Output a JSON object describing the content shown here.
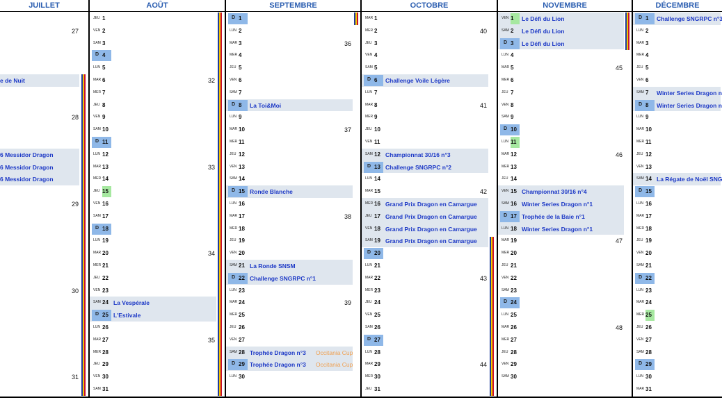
{
  "months": [
    {
      "name": "JUILLET",
      "key": "jul",
      "events": [
        {
          "day": 6,
          "text": "e de Nuit"
        },
        {
          "day": 12,
          "text": "6 Messidor Dragon"
        },
        {
          "day": 13,
          "text": "6 Messidor Dragon"
        },
        {
          "day": 14,
          "text": "6 Messidor Dragon"
        }
      ],
      "weeks": [
        {
          "day": 2,
          "wk": "27"
        },
        {
          "day": 9,
          "wk": "28"
        },
        {
          "day": 16,
          "wk": "29"
        },
        {
          "day": 23,
          "wk": "30"
        },
        {
          "day": 30,
          "wk": "31"
        }
      ]
    },
    {
      "name": "AOÛT",
      "key": "aug",
      "days": [
        {
          "d": "1",
          "w": "JEU"
        },
        {
          "d": "2",
          "w": "VEN"
        },
        {
          "d": "3",
          "w": "SAM"
        },
        {
          "d": "4",
          "w": "D"
        },
        {
          "d": "5",
          "w": "LUN"
        },
        {
          "d": "6",
          "w": "MAR"
        },
        {
          "d": "7",
          "w": "MER"
        },
        {
          "d": "8",
          "w": "JEU"
        },
        {
          "d": "9",
          "w": "VEN"
        },
        {
          "d": "10",
          "w": "SAM"
        },
        {
          "d": "11",
          "w": "D"
        },
        {
          "d": "12",
          "w": "LUN"
        },
        {
          "d": "13",
          "w": "MAR"
        },
        {
          "d": "14",
          "w": "MER"
        },
        {
          "d": "15",
          "w": "JEU",
          "hol": true
        },
        {
          "d": "16",
          "w": "VEN"
        },
        {
          "d": "17",
          "w": "SAM"
        },
        {
          "d": "18",
          "w": "D"
        },
        {
          "d": "19",
          "w": "LUN"
        },
        {
          "d": "20",
          "w": "MAR"
        },
        {
          "d": "21",
          "w": "MER"
        },
        {
          "d": "22",
          "w": "JEU"
        },
        {
          "d": "23",
          "w": "VEN"
        },
        {
          "d": "24",
          "w": "SAM",
          "ev": "La Vespérale"
        },
        {
          "d": "25",
          "w": "D",
          "ev": "L'Estivale"
        },
        {
          "d": "26",
          "w": "LUN"
        },
        {
          "d": "27",
          "w": "MAR"
        },
        {
          "d": "28",
          "w": "MER"
        },
        {
          "d": "29",
          "w": "JEU"
        },
        {
          "d": "30",
          "w": "VEN"
        },
        {
          "d": "31",
          "w": "SAM"
        }
      ],
      "weeks": [
        {
          "day": 6,
          "wk": "32"
        },
        {
          "day": 13,
          "wk": "33"
        },
        {
          "day": 20,
          "wk": "34"
        },
        {
          "day": 27,
          "wk": "35"
        }
      ]
    },
    {
      "name": "SEPTEMBRE",
      "key": "sep",
      "days": [
        {
          "d": "1",
          "w": "D"
        },
        {
          "d": "2",
          "w": "LUN"
        },
        {
          "d": "3",
          "w": "MAR"
        },
        {
          "d": "4",
          "w": "MER"
        },
        {
          "d": "5",
          "w": "JEU"
        },
        {
          "d": "6",
          "w": "VEN"
        },
        {
          "d": "7",
          "w": "SAM"
        },
        {
          "d": "8",
          "w": "D",
          "ev": "La Toi&Moi"
        },
        {
          "d": "9",
          "w": "LUN"
        },
        {
          "d": "10",
          "w": "MAR"
        },
        {
          "d": "11",
          "w": "MER"
        },
        {
          "d": "12",
          "w": "JEU"
        },
        {
          "d": "13",
          "w": "VEN"
        },
        {
          "d": "14",
          "w": "SAM"
        },
        {
          "d": "15",
          "w": "D",
          "ev": "Ronde Blanche"
        },
        {
          "d": "16",
          "w": "LUN"
        },
        {
          "d": "17",
          "w": "MAR"
        },
        {
          "d": "18",
          "w": "MER"
        },
        {
          "d": "19",
          "w": "JEU"
        },
        {
          "d": "20",
          "w": "VEN"
        },
        {
          "d": "21",
          "w": "SAM",
          "ev": "La Ronde SNSM"
        },
        {
          "d": "22",
          "w": "D",
          "ev": "Challenge SNGRPC n°1"
        },
        {
          "d": "23",
          "w": "LUN"
        },
        {
          "d": "24",
          "w": "MAR"
        },
        {
          "d": "25",
          "w": "MER"
        },
        {
          "d": "26",
          "w": "JEU"
        },
        {
          "d": "27",
          "w": "VEN"
        },
        {
          "d": "28",
          "w": "SAM",
          "ev": "Trophée Dragon n°3",
          "ev2": "Occitania Cup"
        },
        {
          "d": "29",
          "w": "D",
          "ev": "Trophée Dragon n°3",
          "ev2": "Occitania Cup"
        },
        {
          "d": "30",
          "w": "LUN"
        }
      ],
      "weeks": [
        {
          "day": 3,
          "wk": "36"
        },
        {
          "day": 10,
          "wk": "37"
        },
        {
          "day": 17,
          "wk": "38"
        },
        {
          "day": 24,
          "wk": "39"
        }
      ]
    },
    {
      "name": "OCTOBRE",
      "key": "oct",
      "days": [
        {
          "d": "1",
          "w": "MAR"
        },
        {
          "d": "2",
          "w": "MER"
        },
        {
          "d": "3",
          "w": "JEU"
        },
        {
          "d": "4",
          "w": "VEN"
        },
        {
          "d": "5",
          "w": "SAM"
        },
        {
          "d": "6",
          "w": "D",
          "ev": "Challenge Voile Légère"
        },
        {
          "d": "7",
          "w": "LUN"
        },
        {
          "d": "8",
          "w": "MAR"
        },
        {
          "d": "9",
          "w": "MER"
        },
        {
          "d": "10",
          "w": "JEU"
        },
        {
          "d": "11",
          "w": "VEN"
        },
        {
          "d": "12",
          "w": "SAM",
          "ev": "Championnat 30/16 n°3"
        },
        {
          "d": "13",
          "w": "D",
          "ev": "Challenge SNGRPC n°2"
        },
        {
          "d": "14",
          "w": "LUN"
        },
        {
          "d": "15",
          "w": "MAR"
        },
        {
          "d": "16",
          "w": "MER",
          "ev": "Grand Prix Dragon en Camargue"
        },
        {
          "d": "17",
          "w": "JEU",
          "ev": "Grand Prix Dragon en Camargue"
        },
        {
          "d": "18",
          "w": "VEN",
          "ev": "Grand Prix Dragon en Camargue"
        },
        {
          "d": "19",
          "w": "SAM",
          "ev": "Grand Prix Dragon en Camargue"
        },
        {
          "d": "20",
          "w": "D"
        },
        {
          "d": "21",
          "w": "LUN"
        },
        {
          "d": "22",
          "w": "MAR"
        },
        {
          "d": "23",
          "w": "MER"
        },
        {
          "d": "24",
          "w": "JEU"
        },
        {
          "d": "25",
          "w": "VEN"
        },
        {
          "d": "26",
          "w": "SAM"
        },
        {
          "d": "27",
          "w": "D"
        },
        {
          "d": "28",
          "w": "LUN"
        },
        {
          "d": "29",
          "w": "MAR"
        },
        {
          "d": "30",
          "w": "MER"
        },
        {
          "d": "31",
          "w": "JEU"
        }
      ],
      "weeks": [
        {
          "day": 2,
          "wk": "40"
        },
        {
          "day": 8,
          "wk": "41"
        },
        {
          "day": 15,
          "wk": "42"
        },
        {
          "day": 22,
          "wk": "43"
        },
        {
          "day": 29,
          "wk": "44"
        }
      ]
    },
    {
      "name": "NOVEMBRE",
      "key": "nov",
      "days": [
        {
          "d": "1",
          "w": "VEN",
          "hol": true,
          "ev": "Le Défi du Lion"
        },
        {
          "d": "2",
          "w": "SAM",
          "ev": "Le Défi du Lion"
        },
        {
          "d": "3",
          "w": "D",
          "ev": "Le Défi du Lion"
        },
        {
          "d": "4",
          "w": "LUN"
        },
        {
          "d": "5",
          "w": "MAR"
        },
        {
          "d": "6",
          "w": "MER"
        },
        {
          "d": "7",
          "w": "JEU"
        },
        {
          "d": "8",
          "w": "VEN"
        },
        {
          "d": "9",
          "w": "SAM"
        },
        {
          "d": "10",
          "w": "D"
        },
        {
          "d": "11",
          "w": "LUN",
          "hol": true
        },
        {
          "d": "12",
          "w": "MAR"
        },
        {
          "d": "13",
          "w": "MER"
        },
        {
          "d": "14",
          "w": "JEU"
        },
        {
          "d": "15",
          "w": "VEN",
          "ev": "Championnat 30/16 n°4"
        },
        {
          "d": "16",
          "w": "SAM",
          "ev": "Winter Series Dragon n°1"
        },
        {
          "d": "17",
          "w": "D",
          "ev": "Trophée de la Baie n°1"
        },
        {
          "d": "18",
          "w": "LUN",
          "ev": "Winter Series Dragon n°1"
        },
        {
          "d": "19",
          "w": "MAR"
        },
        {
          "d": "20",
          "w": "MER"
        },
        {
          "d": "21",
          "w": "JEU"
        },
        {
          "d": "22",
          "w": "VEN"
        },
        {
          "d": "23",
          "w": "SAM"
        },
        {
          "d": "24",
          "w": "D"
        },
        {
          "d": "25",
          "w": "LUN"
        },
        {
          "d": "26",
          "w": "MAR"
        },
        {
          "d": "27",
          "w": "MER"
        },
        {
          "d": "28",
          "w": "JEU"
        },
        {
          "d": "29",
          "w": "VEN"
        },
        {
          "d": "30",
          "w": "SAM"
        }
      ],
      "weeks": [
        {
          "day": 5,
          "wk": "45"
        },
        {
          "day": 12,
          "wk": "46"
        },
        {
          "day": 19,
          "wk": "47"
        },
        {
          "day": 26,
          "wk": "48"
        }
      ]
    },
    {
      "name": "DÉCEMBRE",
      "key": "dec",
      "days": [
        {
          "d": "1",
          "w": "D",
          "ev": "Challenge SNGRPC n°3"
        },
        {
          "d": "2",
          "w": "LUN"
        },
        {
          "d": "3",
          "w": "MAR"
        },
        {
          "d": "4",
          "w": "MER"
        },
        {
          "d": "5",
          "w": "JEU"
        },
        {
          "d": "6",
          "w": "VEN"
        },
        {
          "d": "7",
          "w": "SAM",
          "ev": "Winter Series Dragon n"
        },
        {
          "d": "8",
          "w": "D",
          "ev": "Winter Series Dragon n"
        },
        {
          "d": "9",
          "w": "LUN"
        },
        {
          "d": "10",
          "w": "MAR"
        },
        {
          "d": "11",
          "w": "MER"
        },
        {
          "d": "12",
          "w": "JEU"
        },
        {
          "d": "13",
          "w": "VEN"
        },
        {
          "d": "14",
          "w": "SAM",
          "ev": "La Régate de Noël SNG"
        },
        {
          "d": "15",
          "w": "D"
        },
        {
          "d": "16",
          "w": "LUN"
        },
        {
          "d": "17",
          "w": "MAR"
        },
        {
          "d": "18",
          "w": "MER"
        },
        {
          "d": "19",
          "w": "JEU"
        },
        {
          "d": "20",
          "w": "VEN"
        },
        {
          "d": "21",
          "w": "SAM"
        },
        {
          "d": "22",
          "w": "D"
        },
        {
          "d": "23",
          "w": "LUN"
        },
        {
          "d": "24",
          "w": "MAR"
        },
        {
          "d": "25",
          "w": "MER",
          "hol": true
        },
        {
          "d": "26",
          "w": "JEU"
        },
        {
          "d": "27",
          "w": "VEN"
        },
        {
          "d": "28",
          "w": "SAM"
        },
        {
          "d": "29",
          "w": "D"
        },
        {
          "d": "30",
          "w": "LUN"
        },
        {
          "d": "31",
          "w": "MAR"
        }
      ],
      "weeks": []
    }
  ],
  "colors": {
    "sunday": "#8fb8e8",
    "holiday": "#a6e8a0",
    "event_text": "#1d39c6",
    "event_bg": "#dfe6ee",
    "secondary_text": "#f0a050",
    "header_text": "#2a5db0",
    "flag_blue": "#1f3c9c",
    "flag_yellow": "#f2c500",
    "flag_red": "#c8102e"
  }
}
